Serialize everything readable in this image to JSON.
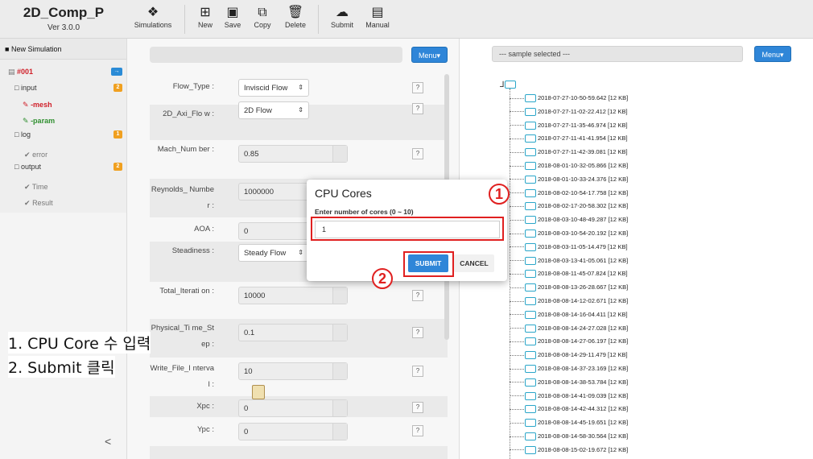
{
  "app": {
    "title": "2D_Comp_P",
    "version": "Ver 3.0.0"
  },
  "toolbar": {
    "simulations": "Simulations",
    "new": "New",
    "save": "Save",
    "copy": "Copy",
    "delete": "Delete",
    "submit": "Submit",
    "manual": "Manual"
  },
  "sidebar": {
    "header": "New Simulation",
    "items": [
      {
        "label": "#001",
        "badge": "→"
      },
      {
        "label": "input",
        "badge": "2"
      },
      {
        "label": "-mesh"
      },
      {
        "label": "-param"
      },
      {
        "label": "log",
        "badge": "1"
      },
      {
        "label": "error"
      },
      {
        "label": "output",
        "badge": "2"
      },
      {
        "label": "Time"
      },
      {
        "label": "Result"
      }
    ],
    "collapse": "<"
  },
  "middle": {
    "menu_label": "Menu▾"
  },
  "form": {
    "fields": [
      {
        "label": "Flow_Type :",
        "value": "Inviscid Flow"
      },
      {
        "label": "2D_Axi_Flo w :",
        "value": "2D Flow"
      },
      {
        "label": "Mach_Num ber :",
        "value": "0.85"
      },
      {
        "label": "Reynolds_ Number :",
        "value": "1000000"
      },
      {
        "label": "AOA :",
        "value": "0"
      },
      {
        "label": "Steadiness :",
        "value": "Steady Flow"
      },
      {
        "label": "Total_Iterati on :",
        "value": "10000"
      },
      {
        "label": "Physical_Ti me_Step :",
        "value": "0.1"
      },
      {
        "label": "Write_File_I nterval :",
        "value": "10"
      },
      {
        "label": "Xpc :",
        "value": "0"
      },
      {
        "label": "Ypc :",
        "value": "0"
      }
    ],
    "help": "?"
  },
  "right": {
    "sample_placeholder": "--- sample selected ---",
    "menu_label": "Menu▾",
    "files": [
      "2018-07-27-10-50-59.642 [12 KB]",
      "2018-07-27-11-02-22.412 [12 KB]",
      "2018-07-27-11-35-46.974 [12 KB]",
      "2018-07-27-11-41-41.954 [12 KB]",
      "2018-07-27-11-42-39.081 [12 KB]",
      "2018-08-01-10-32-05.866 [12 KB]",
      "2018-08-01-10-33-24.376 [12 KB]",
      "2018-08-02-10-54-17.758 [12 KB]",
      "2018-08-02-17-20-58.302 [12 KB]",
      "2018-08-03-10-48-49.287 [12 KB]",
      "2018-08-03-10-54-20.192 [12 KB]",
      "2018-08-03-11-05-14.479 [12 KB]",
      "2018-08-03-13-41-05.061 [12 KB]",
      "2018-08-08-11-45-07.824 [12 KB]",
      "2018-08-08-13-26-28.667 [12 KB]",
      "2018-08-08-14-12-02.671 [12 KB]",
      "2018-08-08-14-16-04.411 [12 KB]",
      "2018-08-08-14-24-27.028 [12 KB]",
      "2018-08-08-14-27-06.197 [12 KB]",
      "2018-08-08-14-29-11.479 [12 KB]",
      "2018-08-08-14-37-23.169 [12 KB]",
      "2018-08-08-14-38-53.784 [12 KB]",
      "2018-08-08-14-41-09.039 [12 KB]",
      "2018-08-08-14-42-44.312 [12 KB]",
      "2018-08-08-14-45-19.651 [12 KB]",
      "2018-08-08-14-58-30.564 [12 KB]",
      "2018-08-08-15-02-19.672 [12 KB]"
    ]
  },
  "modal": {
    "title": "CPU Cores",
    "label": "Enter number of cores (0 ~ 10)",
    "value": "1",
    "submit": "SUBMIT",
    "cancel": "CANCEL"
  },
  "annotations": {
    "step1_marker": "1",
    "step2_marker": "2",
    "note1": "1. CPU Core 수 입력",
    "note2": "2. Submit 클릭"
  }
}
